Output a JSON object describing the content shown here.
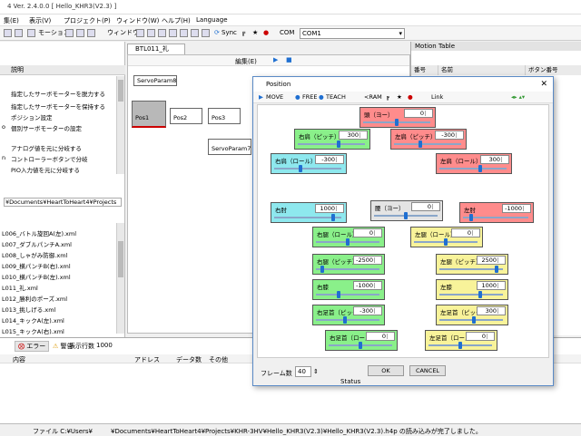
{
  "window": {
    "title": "4 Ver. 2.4.0.0 [ Hello_KHR3(V2.3) ]"
  },
  "menu": [
    "集(E)",
    "表示(V)",
    "プロジェクト(P)",
    "ウィンドウ(W)",
    "ヘルプ(H)",
    "Language"
  ],
  "toolbar": {
    "motion": "モーション",
    "window": "ウィンドウ",
    "sync": "Sync",
    "com_label": "COM",
    "com_value": "COM1"
  },
  "left_panel": {
    "desc_header": "説明",
    "desc_items": [
      "指定したサーボモーターを脱力する",
      "指定したサーボモーターを保持する",
      "ポジション設定",
      "個別サーボモーターの設定",
      "",
      "アナログ値を元に分岐する",
      "コントローラーボタンで分岐",
      "PIO入力値を元に分岐する"
    ],
    "desc_prefix_4": "o",
    "desc_prefix_6": "n",
    "path": "¥Documents¥HeartToHeart4¥Projects",
    "files": [
      "L006_バトル旋回A(左).xml",
      "L007_ダブルパンチA.xml",
      "L008_しゃがみ防御.xml",
      "L009_横パンチB(右).xml",
      "L010_横パンチB(左).xml",
      "L011_礼.xml",
      "L012_勝利のポーズ.xml",
      "L013_挑しげる.xml",
      "L014_キックA(左).xml",
      "L015_キックA(右).xml"
    ]
  },
  "editor": {
    "tab": "BTL011_礼",
    "nodes": [
      "ServoParam8",
      "Pos1",
      "Pos2",
      "Pos3",
      "ServoParam7"
    ],
    "toolbar_edit": "編集(E)"
  },
  "motion_table": {
    "title": "Motion Table",
    "col_num": "番号",
    "col_name": "名前",
    "col_btn": "ボタン番号"
  },
  "bottom_panel": {
    "error_tab": "エラー",
    "warn_tab": "警告",
    "show_rows_label": "表示行数",
    "show_rows_value": "1000",
    "cols": [
      "内容",
      "アドレス",
      "データ数",
      "その他"
    ]
  },
  "status_bar": {
    "text": "ファイル C:¥Users¥",
    "text2": "¥Documents¥HeartToHeart4¥Projects¥KHR-3HV¥Hello_KHR3(V2.3)¥Hello_KHR3(V2.3).h4p の読み込みが完了しました。"
  },
  "dialog": {
    "title": "Position",
    "tools": [
      "MOVE",
      "FREE",
      "TEACH",
      "<RAM",
      "Link"
    ],
    "servos": [
      {
        "label": "頭（ヨー）",
        "value": "0",
        "color": "red",
        "level": 0.5
      },
      {
        "label": "右肩（ピッチ）",
        "value": "300",
        "color": "green",
        "level": 0.62
      },
      {
        "label": "左肩（ピッチ）",
        "value": "-300",
        "color": "red",
        "level": 0.38
      },
      {
        "label": "右肩（ロール）",
        "value": "-300",
        "color": "cyan",
        "level": 0.38
      },
      {
        "label": "左肩（ロール）",
        "value": "300",
        "color": "red",
        "level": 0.62
      },
      {
        "label": "右肘",
        "value": "1000",
        "color": "cyan",
        "level": 0.9
      },
      {
        "label": "腰（ヨー）",
        "value": "0",
        "color": "gray",
        "level": 0.5
      },
      {
        "label": "左肘",
        "value": "-1000",
        "color": "red",
        "level": 0.1
      },
      {
        "label": "右腿（ロール）",
        "value": "0",
        "color": "green",
        "level": 0.5
      },
      {
        "label": "左腿（ロール）",
        "value": "0",
        "color": "yellow",
        "level": 0.5
      },
      {
        "label": "右腿（ピッチ）",
        "value": "-2500",
        "color": "green",
        "level": 0.08
      },
      {
        "label": "左腿（ピッチ）",
        "value": "2500",
        "color": "yellow",
        "level": 0.92
      },
      {
        "label": "右膝",
        "value": "-1000",
        "color": "green",
        "level": 0.35
      },
      {
        "label": "左膝",
        "value": "1000",
        "color": "yellow",
        "level": 0.65
      },
      {
        "label": "右足首（ピッチ）",
        "value": "-300",
        "color": "green",
        "level": 0.45
      },
      {
        "label": "左足首（ピッチ）",
        "value": "300",
        "color": "yellow",
        "level": 0.55
      },
      {
        "label": "右足首（ロール）",
        "value": "0",
        "color": "green",
        "level": 0.5
      },
      {
        "label": "左足首（ロール）",
        "value": "0",
        "color": "yellow",
        "level": 0.5
      }
    ],
    "frames_label": "フレーム数",
    "frames_value": "40",
    "status_label": "Status",
    "ok": "OK",
    "cancel": "CANCEL"
  }
}
